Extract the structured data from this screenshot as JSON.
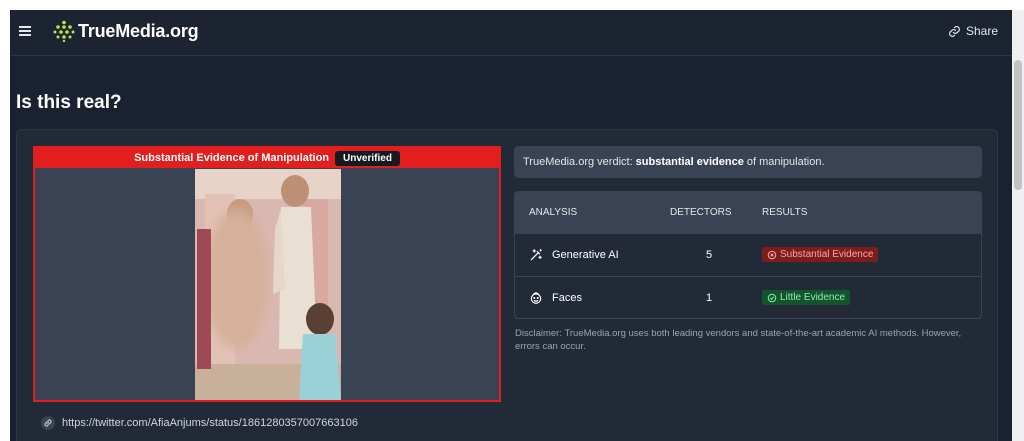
{
  "header": {
    "brand": "TrueMedia.org",
    "share_label": "Share",
    "icons": [
      "menu-icon",
      "truemedia-logo-icon",
      "share-link-icon"
    ]
  },
  "page": {
    "title": "Is this real?"
  },
  "media": {
    "banner_text": "Substantial Evidence of Manipulation",
    "status_badge": "Unverified",
    "source_url": "https://twitter.com/AfiaAnjums/status/1861280357007663106"
  },
  "verdict": {
    "prefix": "TrueMedia.org verdict:",
    "emphasis": "substantial evidence",
    "suffix": "of manipulation."
  },
  "analysis_table": {
    "headers": {
      "analysis": "ANALYSIS",
      "detectors": "DETECTORS",
      "results": "RESULTS"
    },
    "rows": [
      {
        "name": "Generative AI",
        "detectors": "5",
        "result": "Substantial Evidence",
        "icon": "generative-ai-icon",
        "status_color": "#7a1d1d"
      },
      {
        "name": "Faces",
        "detectors": "1",
        "result": "Little Evidence",
        "icon": "face-icon",
        "status_color": "#14532d"
      }
    ]
  },
  "disclaimer": "Disclaimer: TrueMedia.org uses both leading vendors and state-of-the-art academic AI methods. However, errors can occur.",
  "colors": {
    "background": "#1a2130",
    "manipulation_red": "#e21e1e",
    "panel": "#394354"
  }
}
